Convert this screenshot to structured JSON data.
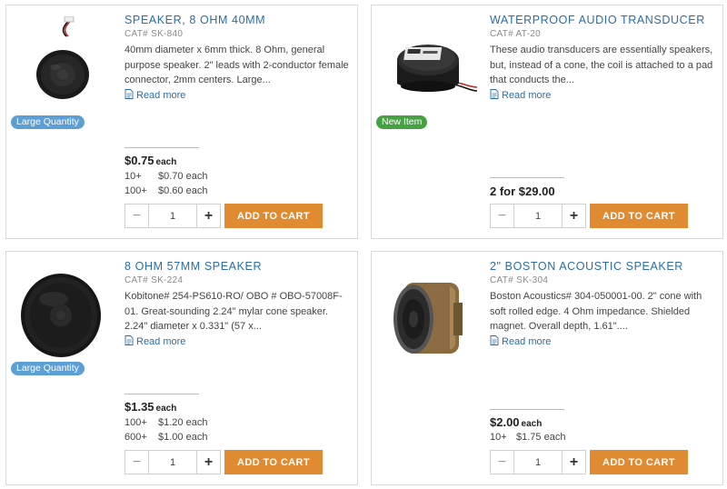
{
  "products": [
    {
      "title": "SPEAKER, 8 OHM 40MM",
      "cat": "CAT# SK-840",
      "description": "40mm diameter x 6mm thick. 8 Ohm, general purpose speaker. 2\" leads with 2-conductor female connector, 2mm centers. Large...",
      "read_more": "Read more",
      "badge": "Large Quantity",
      "price": "$0.75",
      "price_unit": "each",
      "tiers": [
        {
          "qty": "10+",
          "price": "$0.70 each"
        },
        {
          "qty": "100+",
          "price": "$0.60 each"
        }
      ],
      "quantity": "1",
      "add_to_cart": "ADD TO CART"
    },
    {
      "title": "WATERPROOF AUDIO TRANSDUCER",
      "cat": "CAT# AT-20",
      "description": "These audio transducers are essentially speakers, but, instead of a cone, the coil is attached to a pad that conducts the...",
      "read_more": "Read more",
      "badge": "New Item",
      "price": "2 for $29.00",
      "price_unit": "",
      "tiers": [],
      "quantity": "1",
      "add_to_cart": "ADD TO CART"
    },
    {
      "title": "8 OHM 57MM SPEAKER",
      "cat": "CAT# SK-224",
      "description": "Kobitone# 254-PS610-RO/ OBO # OBO-57008F-01. Great-sounding 2.24\" mylar cone speaker. 2.24\" diameter x 0.331\" (57 x...",
      "read_more": "Read more",
      "badge": "Large Quantity",
      "price": "$1.35",
      "price_unit": "each",
      "tiers": [
        {
          "qty": "100+",
          "price": "$1.20 each"
        },
        {
          "qty": "600+",
          "price": "$1.00 each"
        }
      ],
      "quantity": "1",
      "add_to_cart": "ADD TO CART"
    },
    {
      "title": "2\" BOSTON ACOUSTIC SPEAKER",
      "cat": "CAT# SK-304",
      "description": "Boston Acoustics# 304-050001-00. 2\" cone with soft rolled edge. 4 Ohm impedance. Shielded magnet. Overall depth, 1.61\"....",
      "read_more": "Read more",
      "badge": "",
      "price": "$2.00",
      "price_unit": "each",
      "tiers": [
        {
          "qty": "10+",
          "price": "$1.75 each"
        }
      ],
      "quantity": "1",
      "add_to_cart": "ADD TO CART"
    }
  ],
  "icons": {
    "minus": "minus-icon",
    "plus": "plus-icon",
    "read_more": "document-icon"
  },
  "colors": {
    "title": "#2b6ea6",
    "add_to_cart": "#e08a31",
    "badge_large_quantity": "#5b9fd6",
    "badge_new_item": "#46a143"
  }
}
